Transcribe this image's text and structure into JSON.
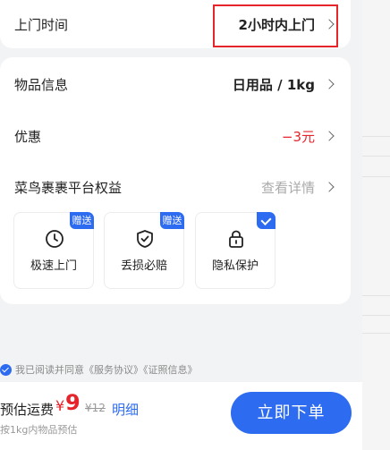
{
  "pickup": {
    "label": "上门时间",
    "value": "2小时内上门"
  },
  "item": {
    "label": "物品信息",
    "value": "日用品 / 1kg"
  },
  "discount": {
    "label": "优惠",
    "value": "−3元",
    "color": "#e5242b"
  },
  "rights": {
    "label": "菜鸟裹裹平台权益",
    "detail": "查看详情",
    "benefits": [
      {
        "name": "极速上门",
        "icon": "clock-icon",
        "tag": "赠送"
      },
      {
        "name": "丢损必赔",
        "icon": "shield-check-icon",
        "tag": "赠送"
      },
      {
        "name": "隐私保护",
        "icon": "lock-icon",
        "tag": "check"
      }
    ]
  },
  "agreement": {
    "text": "我已阅读并同意《服务协议》《证照信息》",
    "checked": true
  },
  "bottom": {
    "price_label": "预估运费",
    "currency": "¥",
    "price": "9",
    "original_price": "¥12",
    "detail_link": "明细",
    "note": "按1kg内物品预估",
    "submit": "立即下单"
  },
  "colors": {
    "accent": "#2d6bf0",
    "price": "#e5242b",
    "highlight_box": "#e5242b"
  }
}
